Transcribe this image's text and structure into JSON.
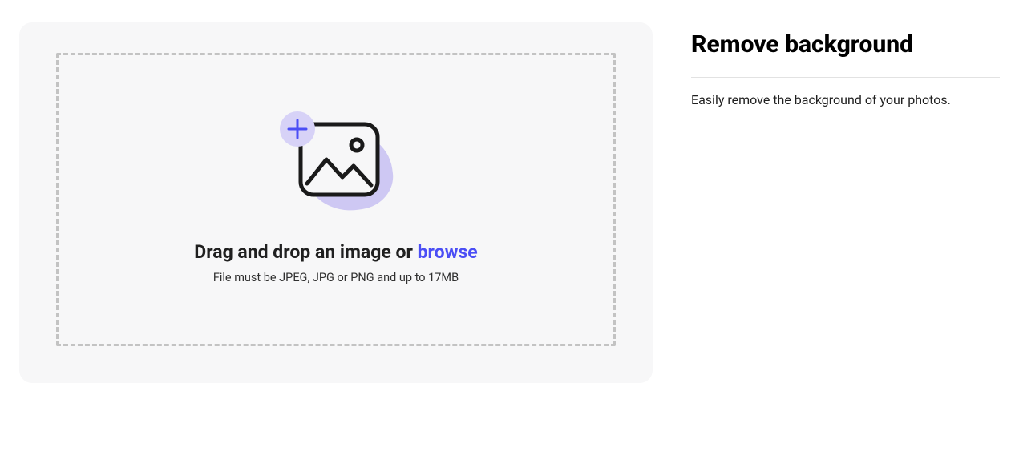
{
  "dropzone": {
    "drag_text": "Drag and drop an image or ",
    "browse_label": "browse",
    "file_hint": "File must be JPEG, JPG or PNG and up to 17MB"
  },
  "sidebar": {
    "title": "Remove background",
    "subtitle": "Easily remove the background of your photos."
  }
}
